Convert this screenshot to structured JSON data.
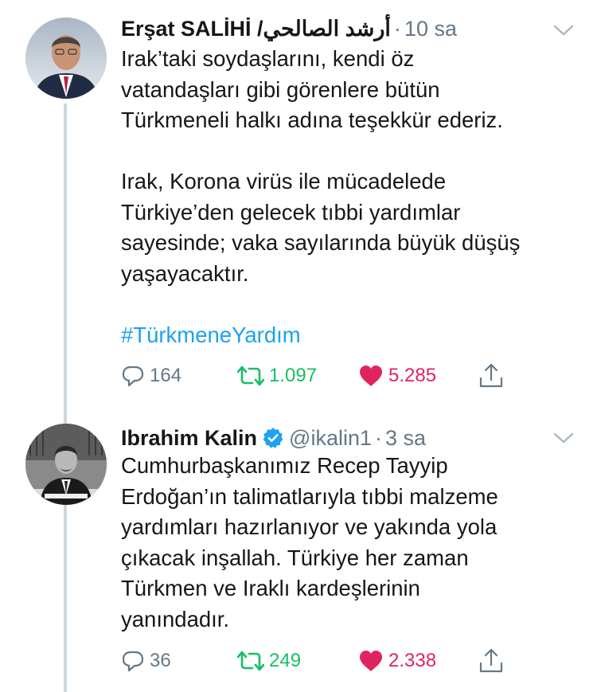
{
  "colors": {
    "accent": "#1da1f2",
    "retweet": "#17bf63",
    "like": "#e0245e",
    "muted": "#657786",
    "thread_line": "#ccd6dd"
  },
  "tweets": [
    {
      "name": "Erşat SALİHİ /أرشد الصالحي",
      "handle": "",
      "verified": false,
      "dot": "·",
      "time": "10 sa",
      "text": "Irak’taki soydaşlarını, kendi öz\nvatandaşları gibi görenlere bütün\nTürkmeneli halkı adına teşekkür ederiz.\n\nIrak, Korona virüs ile mücadelede\nTürkiye’den gelecek tıbbi yardımlar\nsayesinde; vaka sayılarında büyük düşüş\nyaşayacaktır.\n\n",
      "hashtag": "#TürkmeneYardım",
      "replies": "164",
      "retweets": "1.097",
      "likes": "5.285",
      "liked": true,
      "retweeted": true
    },
    {
      "name": "Ibrahim Kalin",
      "handle": "@ikalin1",
      "verified": true,
      "dot": "·",
      "time": "3 sa",
      "text": "Cumhurbaşkanımız Recep Tayyip\nErdoğan’ın talimatlarıyla tıbbi malzeme\nyardımları hazırlanıyor ve yakında yola\nçıkacak inşallah. Türkiye her zaman\nTürkmen ve Iraklı kardeşlerinin\nyanındadır.",
      "hashtag": "",
      "replies": "36",
      "retweets": "249",
      "likes": "2.338",
      "liked": true,
      "retweeted": true
    }
  ],
  "icons": [
    "reply-icon",
    "retweet-icon",
    "like-icon",
    "share-icon",
    "verified-badge-icon",
    "caret-down-icon"
  ]
}
